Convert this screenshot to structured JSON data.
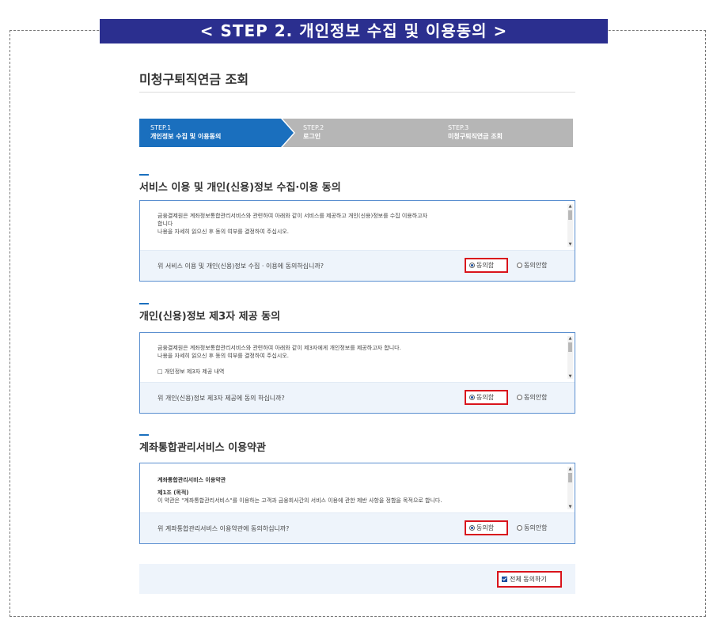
{
  "banner": "< STEP 2. 개인정보 수집 및 이용동의 >",
  "page_title": "미청구퇴직연금 조회",
  "steps": [
    {
      "num": "STEP.1",
      "label": "개인정보 수집 및 이용동의",
      "active": true
    },
    {
      "num": "STEP.2",
      "label": "로그인",
      "active": false
    },
    {
      "num": "STEP.3",
      "label": "미청구퇴직연금 조회",
      "active": false
    }
  ],
  "sections": [
    {
      "title": "서비스 이용 및 개인(신용)정보 수집·이용 동의",
      "lines": [
        "금융결제원은 계좌정보통합관리서비스와 관련하여 아래와 같이 서비스를 제공하고 개인(신용)정보를 수집 이용하고자",
        "합니다",
        "나용을 자세히 읽으신 후 동의 여부를 결정하여 주십시오."
      ],
      "question": "위 서비스 이용 및 개인(신용)정보 수집 · 이용에 동의하십니까?",
      "agree": "동의함",
      "disagree": "동의안함"
    },
    {
      "title": "개인(신용)정보 제3자 제공 동의",
      "lines": [
        "금융결제원은 계좌정보통합관리서비스와 관련하여 아래와 같이 제3자에게 개인정보를 제공하고자 합니다.",
        "나용을 자세히 읽으신 후 동의 여부를 결정하여 주십시오.",
        "",
        "□ 개인정보 제3자 제공 내역"
      ],
      "question": "위 개인(신용)정보 제3자 제공에 동의 하십니까?",
      "agree": "동의함",
      "disagree": "동의안함"
    },
    {
      "title": "계좌통합관리서비스 이용약관",
      "heading": "계좌통합관리서비스 이용약관",
      "lines": [
        "제1조 (목적)",
        "이 약관은 \"계좌통합관리서비스\"를 이용하는 고객과 금융회사간의 서비스 이용에 관한 제반 사항을 정함을 목적으로 합니다."
      ],
      "question": "위 계좌통합관리서비스 이용약관에 동의하십니까?",
      "agree": "동의함",
      "disagree": "동의안함"
    }
  ],
  "all_agree": "전체 동의하기",
  "colors": {
    "banner_bg": "#2b2f8f",
    "active_step": "#1a6fbe",
    "inactive_step": "#b6b6b6",
    "highlight_border": "#d9141c",
    "box_border": "#5a8fd0"
  }
}
